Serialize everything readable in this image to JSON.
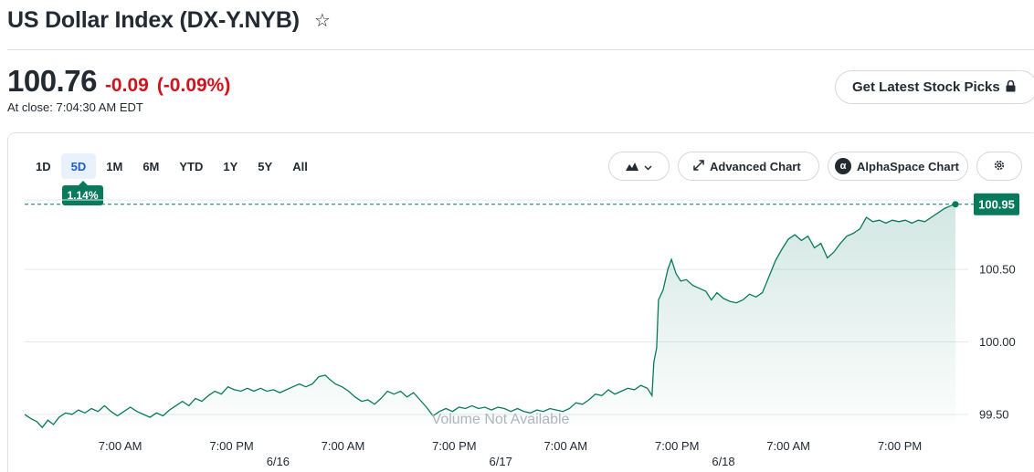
{
  "header": {
    "title": "US Dollar Index (DX-Y.NYB)",
    "watchlist_icon": "star-outline-icon"
  },
  "quote": {
    "price": "100.76",
    "change": "-0.09",
    "change_percent": "(-0.09%)",
    "close_time": "At close: 7:04:30 AM EDT",
    "change_color": "#d1121d"
  },
  "picks_button": {
    "label": "Get Latest Stock Picks",
    "icon": "lock-icon"
  },
  "range_tabs": [
    {
      "label": "1D",
      "active": false
    },
    {
      "label": "5D",
      "active": true
    },
    {
      "label": "1M",
      "active": false
    },
    {
      "label": "6M",
      "active": false
    },
    {
      "label": "YTD",
      "active": false
    },
    {
      "label": "1Y",
      "active": false
    },
    {
      "label": "5Y",
      "active": false
    },
    {
      "label": "All",
      "active": false
    }
  ],
  "performance_badge": "1.14%",
  "toolbar": {
    "chart_type_icon": "mountain-chart-icon",
    "advanced_label": "Advanced Chart",
    "advanced_icon": "expand-icon",
    "alpha_label": "AlphaSpace Chart",
    "alpha_icon": "alpha-icon",
    "settings_icon": "gear-icon"
  },
  "chart_data": {
    "type": "area",
    "title": "",
    "xlabel": "",
    "ylabel": "",
    "ylim": [
      99.43,
      100.98
    ],
    "y_ticks": [
      "100.50",
      "100.00",
      "99.50"
    ],
    "y_tick_values": [
      100.5,
      100.0,
      99.5
    ],
    "last_price_label": "100.95",
    "last_price": 100.95,
    "no_volume_text": "Volume Not Available",
    "x_time_labels": [
      "7:00 AM",
      "7:00 PM",
      "7:00 AM",
      "7:00 PM",
      "7:00 AM",
      "7:00 PM",
      "7:00 AM",
      "7:00 PM"
    ],
    "x_time_hours": [
      7,
      19,
      31,
      43,
      55,
      67,
      79,
      91
    ],
    "x_date_labels": [
      "6/16",
      "6/17",
      "6/18"
    ],
    "x_date_hours": [
      24,
      48,
      72
    ],
    "x_range_hours": [
      -3.3,
      97.0
    ],
    "series": [
      {
        "line_color": "#087a5c",
        "fill_color": "#087a5c",
        "points": [
          [
            -3.3,
            99.5
          ],
          [
            -2.6,
            99.47
          ],
          [
            -2.0,
            99.45
          ],
          [
            -1.4,
            99.41
          ],
          [
            -0.8,
            99.46
          ],
          [
            -0.2,
            99.43
          ],
          [
            0.4,
            99.48
          ],
          [
            1.1,
            99.51
          ],
          [
            1.8,
            99.5
          ],
          [
            2.5,
            99.53
          ],
          [
            3.2,
            99.51
          ],
          [
            3.9,
            99.54
          ],
          [
            4.6,
            99.52
          ],
          [
            5.3,
            99.56
          ],
          [
            6.0,
            99.52
          ],
          [
            6.7,
            99.49
          ],
          [
            7.4,
            99.52
          ],
          [
            8.1,
            99.55
          ],
          [
            8.8,
            99.52
          ],
          [
            9.5,
            99.5
          ],
          [
            10.2,
            99.48
          ],
          [
            10.9,
            99.51
          ],
          [
            11.6,
            99.49
          ],
          [
            12.3,
            99.53
          ],
          [
            13.0,
            99.56
          ],
          [
            13.7,
            99.59
          ],
          [
            14.4,
            99.56
          ],
          [
            15.1,
            99.61
          ],
          [
            15.8,
            99.59
          ],
          [
            16.5,
            99.63
          ],
          [
            17.2,
            99.66
          ],
          [
            17.9,
            99.64
          ],
          [
            18.6,
            99.69
          ],
          [
            19.3,
            99.67
          ],
          [
            20.0,
            99.66
          ],
          [
            20.7,
            99.68
          ],
          [
            21.4,
            99.66
          ],
          [
            22.1,
            99.68
          ],
          [
            22.8,
            99.66
          ],
          [
            23.5,
            99.67
          ],
          [
            24.2,
            99.65
          ],
          [
            24.9,
            99.67
          ],
          [
            25.6,
            99.69
          ],
          [
            26.3,
            99.71
          ],
          [
            27.0,
            99.69
          ],
          [
            27.7,
            99.71
          ],
          [
            28.4,
            99.76
          ],
          [
            29.1,
            99.77
          ],
          [
            29.6,
            99.74
          ],
          [
            30.2,
            99.71
          ],
          [
            30.9,
            99.69
          ],
          [
            31.6,
            99.66
          ],
          [
            32.3,
            99.62
          ],
          [
            33.0,
            99.59
          ],
          [
            33.7,
            99.6
          ],
          [
            34.4,
            99.57
          ],
          [
            35.1,
            99.61
          ],
          [
            35.8,
            99.66
          ],
          [
            36.5,
            99.64
          ],
          [
            37.2,
            99.66
          ],
          [
            37.9,
            99.62
          ],
          [
            38.6,
            99.65
          ],
          [
            39.3,
            99.6
          ],
          [
            40.0,
            99.55
          ],
          [
            40.7,
            99.49
          ],
          [
            41.4,
            99.52
          ],
          [
            42.1,
            99.54
          ],
          [
            42.8,
            99.52
          ],
          [
            43.5,
            99.55
          ],
          [
            44.2,
            99.54
          ],
          [
            44.9,
            99.56
          ],
          [
            45.6,
            99.54
          ],
          [
            46.3,
            99.55
          ],
          [
            47.0,
            99.53
          ],
          [
            47.7,
            99.55
          ],
          [
            48.4,
            99.54
          ],
          [
            49.1,
            99.52
          ],
          [
            49.8,
            99.54
          ],
          [
            50.5,
            99.52
          ],
          [
            51.2,
            99.51
          ],
          [
            51.9,
            99.53
          ],
          [
            52.6,
            99.52
          ],
          [
            53.3,
            99.54
          ],
          [
            54.0,
            99.53
          ],
          [
            54.7,
            99.52
          ],
          [
            55.4,
            99.54
          ],
          [
            56.1,
            99.58
          ],
          [
            56.8,
            99.57
          ],
          [
            57.5,
            99.6
          ],
          [
            58.2,
            99.64
          ],
          [
            58.9,
            99.63
          ],
          [
            59.6,
            99.67
          ],
          [
            60.3,
            99.64
          ],
          [
            61.0,
            99.66
          ],
          [
            61.7,
            99.68
          ],
          [
            62.4,
            99.67
          ],
          [
            63.1,
            99.7
          ],
          [
            63.8,
            99.68
          ],
          [
            64.3,
            99.63
          ],
          [
            64.5,
            99.86
          ],
          [
            64.8,
            99.96
          ],
          [
            65.0,
            100.29
          ],
          [
            65.5,
            100.36
          ],
          [
            66.0,
            100.5
          ],
          [
            66.4,
            100.57
          ],
          [
            66.9,
            100.47
          ],
          [
            67.4,
            100.42
          ],
          [
            68.0,
            100.43
          ],
          [
            68.7,
            100.39
          ],
          [
            69.4,
            100.37
          ],
          [
            70.1,
            100.35
          ],
          [
            70.7,
            100.29
          ],
          [
            71.3,
            100.34
          ],
          [
            72.0,
            100.3
          ],
          [
            72.7,
            100.28
          ],
          [
            73.4,
            100.27
          ],
          [
            74.1,
            100.29
          ],
          [
            74.8,
            100.33
          ],
          [
            75.5,
            100.31
          ],
          [
            76.2,
            100.34
          ],
          [
            76.9,
            100.45
          ],
          [
            77.6,
            100.56
          ],
          [
            78.3,
            100.64
          ],
          [
            79.0,
            100.71
          ],
          [
            79.7,
            100.74
          ],
          [
            80.4,
            100.7
          ],
          [
            81.1,
            100.73
          ],
          [
            81.8,
            100.65
          ],
          [
            82.5,
            100.68
          ],
          [
            83.2,
            100.58
          ],
          [
            83.9,
            100.62
          ],
          [
            84.6,
            100.68
          ],
          [
            85.3,
            100.73
          ],
          [
            86.0,
            100.75
          ],
          [
            86.7,
            100.78
          ],
          [
            87.4,
            100.86
          ],
          [
            88.1,
            100.83
          ],
          [
            88.8,
            100.84
          ],
          [
            89.5,
            100.82
          ],
          [
            90.2,
            100.84
          ],
          [
            90.9,
            100.83
          ],
          [
            91.6,
            100.84
          ],
          [
            92.3,
            100.82
          ],
          [
            93.0,
            100.84
          ],
          [
            93.7,
            100.83
          ],
          [
            94.4,
            100.86
          ],
          [
            95.1,
            100.89
          ],
          [
            95.8,
            100.92
          ],
          [
            96.5,
            100.94
          ],
          [
            97.0,
            100.95
          ]
        ]
      }
    ]
  }
}
